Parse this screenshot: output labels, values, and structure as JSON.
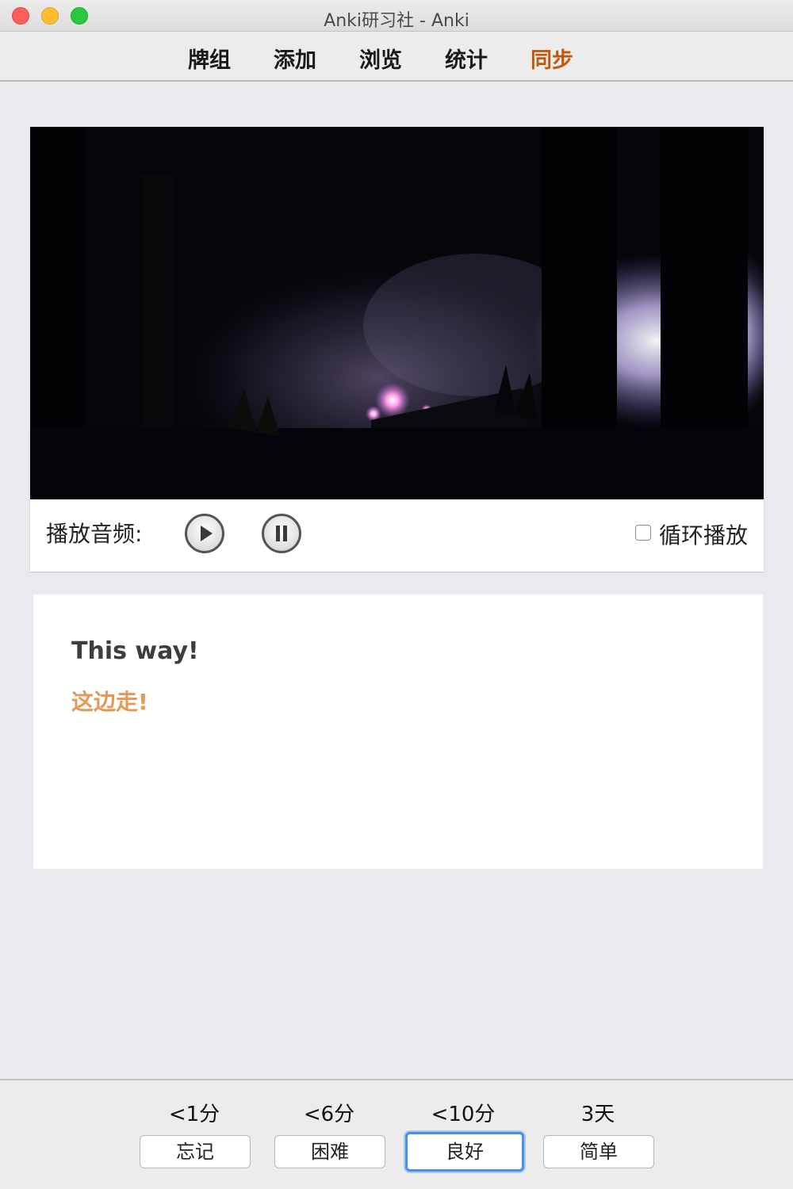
{
  "window": {
    "title": "Anki研习社 - Anki"
  },
  "toolbar": {
    "items": [
      "牌组",
      "添加",
      "浏览",
      "统计",
      "同步"
    ],
    "accent_color": "#c4570e"
  },
  "media": {
    "audio_label": "播放音频:",
    "play_icon": "play-icon",
    "pause_icon": "pause-icon",
    "loop_label": "循环播放",
    "loop_checked": false
  },
  "card": {
    "english": "This way!",
    "chinese": "这边走!",
    "chinese_color": "#e19a58"
  },
  "answer_buttons": [
    {
      "interval": "<1分",
      "label": "忘记"
    },
    {
      "interval": "<6分",
      "label": "困难"
    },
    {
      "interval": "<10分",
      "label": "良好",
      "focused": true
    },
    {
      "interval": "3天",
      "label": "简单"
    }
  ]
}
